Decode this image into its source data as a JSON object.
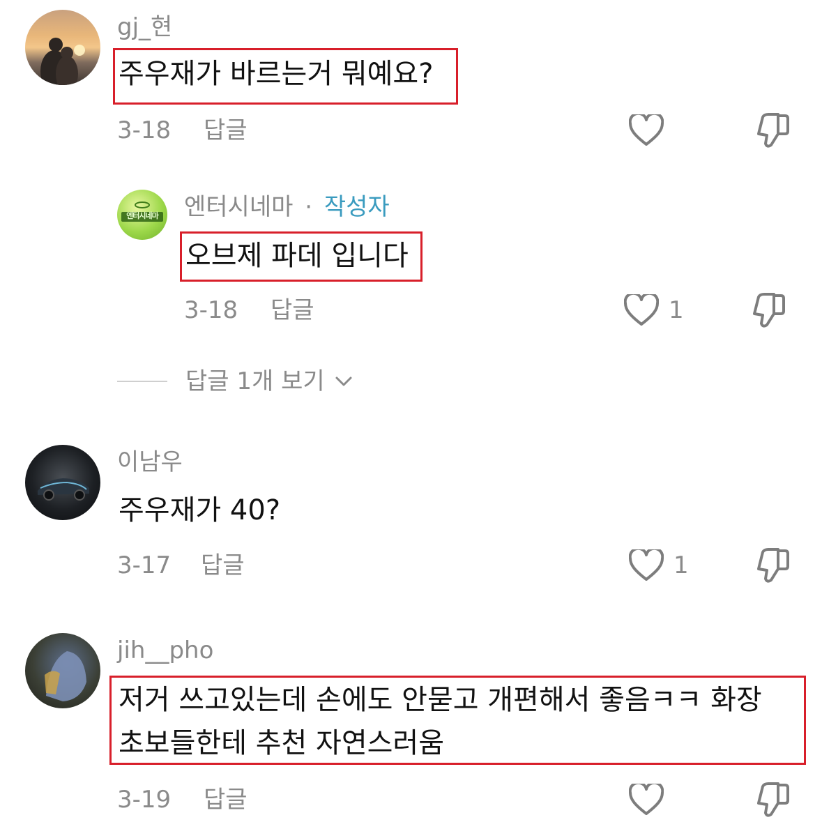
{
  "comments": [
    {
      "username": "gj_현",
      "text": "주우재가 바르는거 뭐예요?",
      "date": "3-18",
      "reply_label": "답글",
      "likes": ""
    },
    {
      "username": "엔터시네마",
      "badge_sep": "·",
      "badge": "작성자",
      "avatar_text": "엔터시네마",
      "text": "오브제 파데 입니다",
      "date": "3-18",
      "reply_label": "답글",
      "likes": "1"
    },
    {
      "username": "이남우",
      "text": "주우재가 40?",
      "date": "3-17",
      "reply_label": "답글",
      "likes": "1"
    },
    {
      "username": "jih__pho",
      "text_line1": "저거 쓰고있는데 손에도 안묻고 개편해서 좋음ㅋㅋ 화장",
      "text_line2": "초보들한테 추천 자연스러움",
      "date": "3-19",
      "reply_label": "답글",
      "likes": ""
    }
  ],
  "view_replies": {
    "label": "답글 1개 보기"
  },
  "icons": {
    "like": "heart-outline-icon",
    "dislike": "thumbs-down-icon",
    "expand": "chevron-down-icon"
  },
  "colors": {
    "highlight": "#d81f2a",
    "author_badge": "#3a9bbf",
    "meta_text": "#8a8a8a"
  }
}
